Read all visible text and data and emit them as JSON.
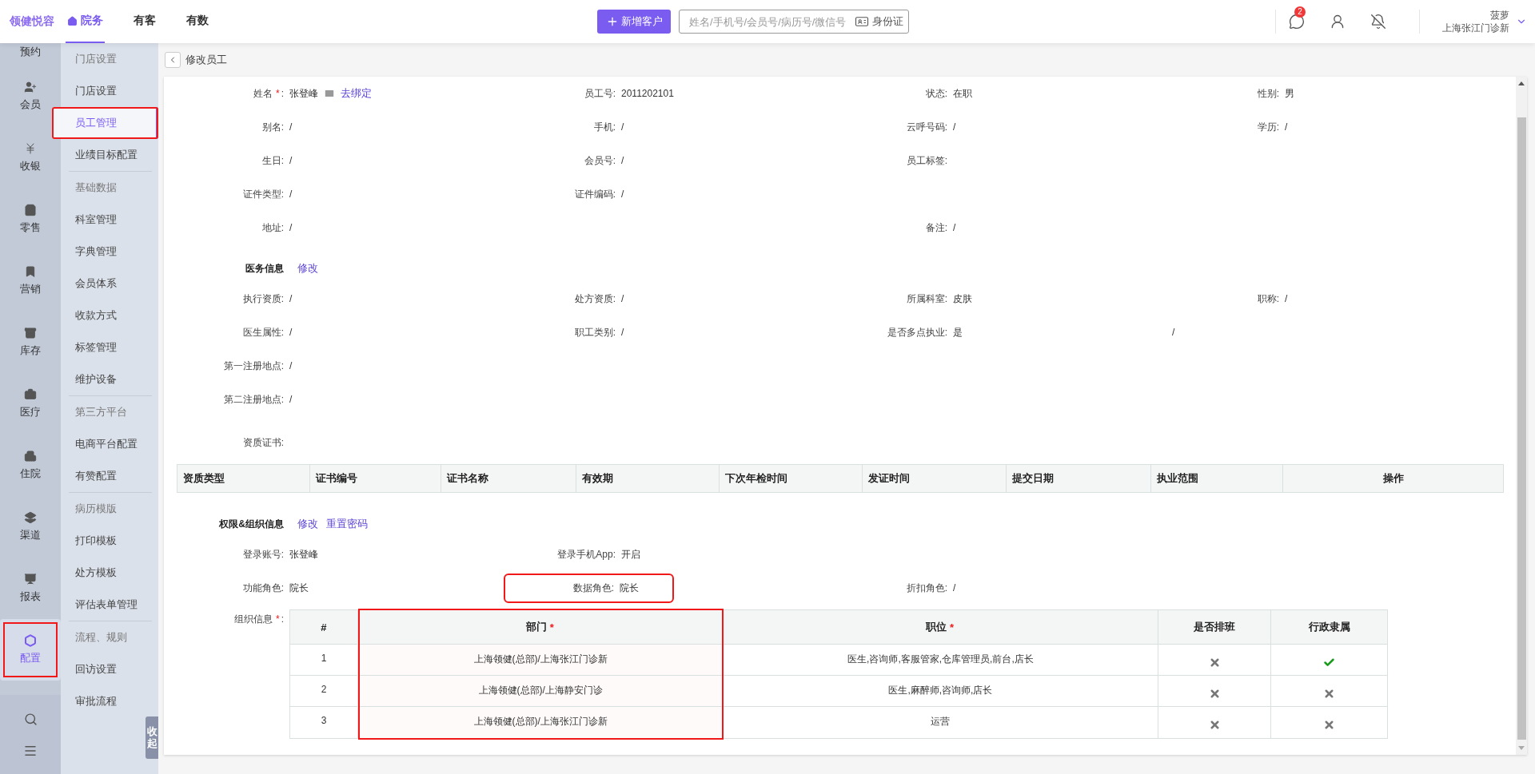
{
  "topbar": {
    "logo": "领健悦容",
    "nav": [
      {
        "label": "院务",
        "selected": true
      },
      {
        "label": "有客",
        "selected": false
      },
      {
        "label": "有数",
        "selected": false
      }
    ],
    "new_button": "新增客户",
    "search": {
      "placeholder": "姓名/手机号/会员号/病历号/微信号",
      "id_button": "身份证"
    },
    "badge": "2",
    "user": {
      "name": "菠萝",
      "clinic": "上海张江门诊新"
    }
  },
  "rail": [
    {
      "label": "预约",
      "selected": false
    },
    {
      "label": "会员",
      "selected": false
    },
    {
      "label": "收银",
      "selected": false
    },
    {
      "label": "零售",
      "selected": false
    },
    {
      "label": "营销",
      "selected": false
    },
    {
      "label": "库存",
      "selected": false
    },
    {
      "label": "医疗",
      "selected": false
    },
    {
      "label": "住院",
      "selected": false
    },
    {
      "label": "渠道",
      "selected": false
    },
    {
      "label": "报表",
      "selected": false
    },
    {
      "label": "配置",
      "selected": true,
      "highlighted": true
    }
  ],
  "sidebar": {
    "groups": [
      [
        {
          "label": "门店设置",
          "kind": "header",
          "selected": false
        },
        {
          "label": "门店设置",
          "kind": "link",
          "selected": false
        },
        {
          "label": "员工管理",
          "kind": "link",
          "selected": true,
          "highlighted": true
        },
        {
          "label": "业绩目标配置",
          "kind": "link",
          "selected": false
        }
      ],
      [
        {
          "label": "基础数据",
          "kind": "header",
          "selected": false
        },
        {
          "label": "科室管理",
          "kind": "link",
          "selected": false
        },
        {
          "label": "字典管理",
          "kind": "link",
          "selected": false
        },
        {
          "label": "会员体系",
          "kind": "link",
          "selected": false
        },
        {
          "label": "收款方式",
          "kind": "link",
          "selected": false
        },
        {
          "label": "标签管理",
          "kind": "link",
          "selected": false
        },
        {
          "label": "维护设备",
          "kind": "link",
          "selected": false
        }
      ],
      [
        {
          "label": "第三方平台",
          "kind": "header",
          "selected": false
        },
        {
          "label": "电商平台配置",
          "kind": "link",
          "selected": false
        },
        {
          "label": "有赞配置",
          "kind": "link",
          "selected": false
        }
      ],
      [
        {
          "label": "病历模版",
          "kind": "header",
          "selected": false
        },
        {
          "label": "打印模板",
          "kind": "link",
          "selected": false
        },
        {
          "label": "处方模板",
          "kind": "link",
          "selected": false
        },
        {
          "label": "评估表单管理",
          "kind": "link",
          "selected": false
        }
      ],
      [
        {
          "label": "流程、规则",
          "kind": "header",
          "selected": false
        },
        {
          "label": "回访设置",
          "kind": "link",
          "selected": false
        },
        {
          "label": "审批流程",
          "kind": "link",
          "selected": false
        }
      ]
    ],
    "collapse": "收起"
  },
  "breadcrumb": "修改员工",
  "basic": {
    "rows": [
      [
        {
          "label": "姓名",
          "required_mark": "*",
          "label_end": ":",
          "value": "张登峰",
          "link": "去绑定"
        },
        {
          "label": "员工号:",
          "value": "2011202101"
        },
        {
          "label": "状态:",
          "value": "在职"
        },
        {
          "label": "性别:",
          "value": "男"
        }
      ],
      [
        {
          "label": "别名:",
          "value": "/"
        },
        {
          "label": "手机:",
          "value": "/"
        },
        {
          "label": "云呼号码:",
          "value": "/"
        },
        {
          "label": "学历:",
          "value": "/"
        }
      ],
      [
        {
          "label": "生日:",
          "value": "/"
        },
        {
          "label": "会员号:",
          "value": "/"
        },
        {
          "label": "员工标签:"
        },
        null
      ],
      [
        {
          "label": "证件类型:",
          "value": "/"
        },
        {
          "label": "证件编码:",
          "value": "/"
        },
        null,
        null
      ],
      [
        {
          "label": "地址:",
          "value": "/"
        },
        null,
        {
          "label": "备注:",
          "value": "/"
        },
        null
      ]
    ]
  },
  "medical": {
    "title": "医务信息",
    "links": [
      "修改"
    ],
    "rows": [
      [
        {
          "label": "执行资质:",
          "value": "/"
        },
        {
          "label": "处方资质:",
          "value": "/"
        },
        {
          "label": "所属科室:",
          "value": "皮肤"
        },
        {
          "label": "职称:",
          "value": "/"
        }
      ],
      [
        {
          "label": "医生属性:",
          "value": "/"
        },
        {
          "label": "职工类别:",
          "value": "/"
        },
        {
          "label": "是否多点执业:",
          "value": "是"
        },
        {
          "value": "/"
        }
      ],
      [
        {
          "label": "第一注册地点:",
          "value": "/"
        },
        null,
        null,
        null
      ],
      [
        {
          "label": "第二注册地点:",
          "value": "/"
        },
        null,
        null,
        null
      ]
    ],
    "cert_label": "资质证书:",
    "cert_columns": [
      "资质类型",
      "证书编号",
      "证书名称",
      "有效期",
      "下次年检时间",
      "发证时间",
      "提交日期",
      "执业范围",
      "操作"
    ]
  },
  "permissions": {
    "title": "权限&组织信息",
    "links": [
      "修改",
      "重置密码"
    ],
    "rows": [
      [
        {
          "label": "登录账号:",
          "value": "张登峰"
        },
        {
          "label": "登录手机App:",
          "value": "开启"
        },
        null,
        null
      ],
      [
        {
          "label": "功能角色:",
          "value": "院长"
        },
        {
          "label": "数据角色:",
          "value": "院长",
          "highlighted": true
        },
        {
          "label": "折扣角色:",
          "value": "/"
        },
        null
      ]
    ],
    "org_label": "组织信息",
    "org_required_mark": "*",
    "org_label_end": ":",
    "org_columns": [
      {
        "label": "#",
        "highlighted": false
      },
      {
        "label": "部门",
        "required_mark": "*",
        "highlighted": true
      },
      {
        "label": "职位",
        "required_mark": "*",
        "highlighted": false
      },
      {
        "label": "是否排班",
        "highlighted": false
      },
      {
        "label": "行政隶属",
        "highlighted": false
      }
    ],
    "org_rows": [
      {
        "index": "1",
        "department": "上海领健(总部)/上海张江门诊新",
        "positions": "医生,咨询师,客服管家,仓库管理员,前台,店长",
        "scheduled": false,
        "admin": true
      },
      {
        "index": "2",
        "department": "上海领健(总部)/上海静安门诊",
        "positions": "医生,麻醉师,咨询师,店长",
        "scheduled": false,
        "admin": false
      },
      {
        "index": "3",
        "department": "上海领健(总部)/上海张江门诊新",
        "positions": "运营",
        "scheduled": false,
        "admin": false
      }
    ]
  }
}
